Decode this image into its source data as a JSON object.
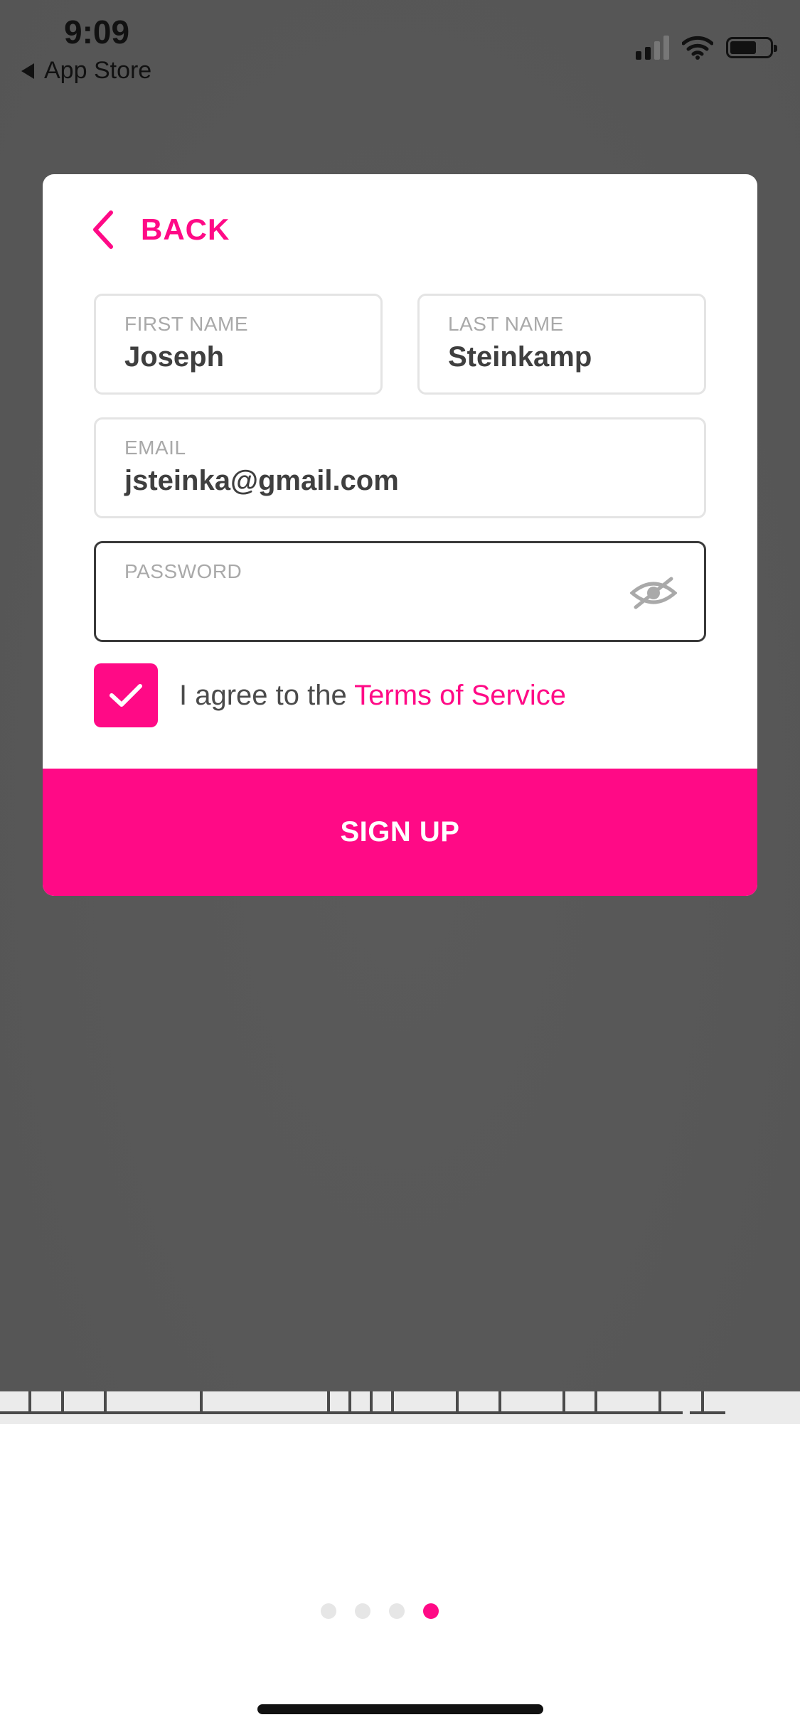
{
  "status_bar": {
    "time": "9:09",
    "back_app": "App Store"
  },
  "form": {
    "back_label": "BACK",
    "first_name": {
      "label": "FIRST NAME",
      "value": "Joseph"
    },
    "last_name": {
      "label": "LAST NAME",
      "value": "Steinkamp"
    },
    "email": {
      "label": "EMAIL",
      "value": "jsteinka@gmail.com"
    },
    "password": {
      "label": "PASSWORD",
      "value": ""
    },
    "agree_text": "I agree to the ",
    "terms_link": "Terms of Service",
    "agree_checked": true,
    "signup_label": "SIGN UP"
  },
  "pager": {
    "total": 4,
    "active_index": 3
  },
  "colors": {
    "accent": "#ff0a86",
    "backdrop": "#585858"
  },
  "icons": [
    "back-chevron-icon",
    "eye-off-icon",
    "checkmark-icon",
    "signal-icon",
    "wifi-icon",
    "battery-icon"
  ]
}
